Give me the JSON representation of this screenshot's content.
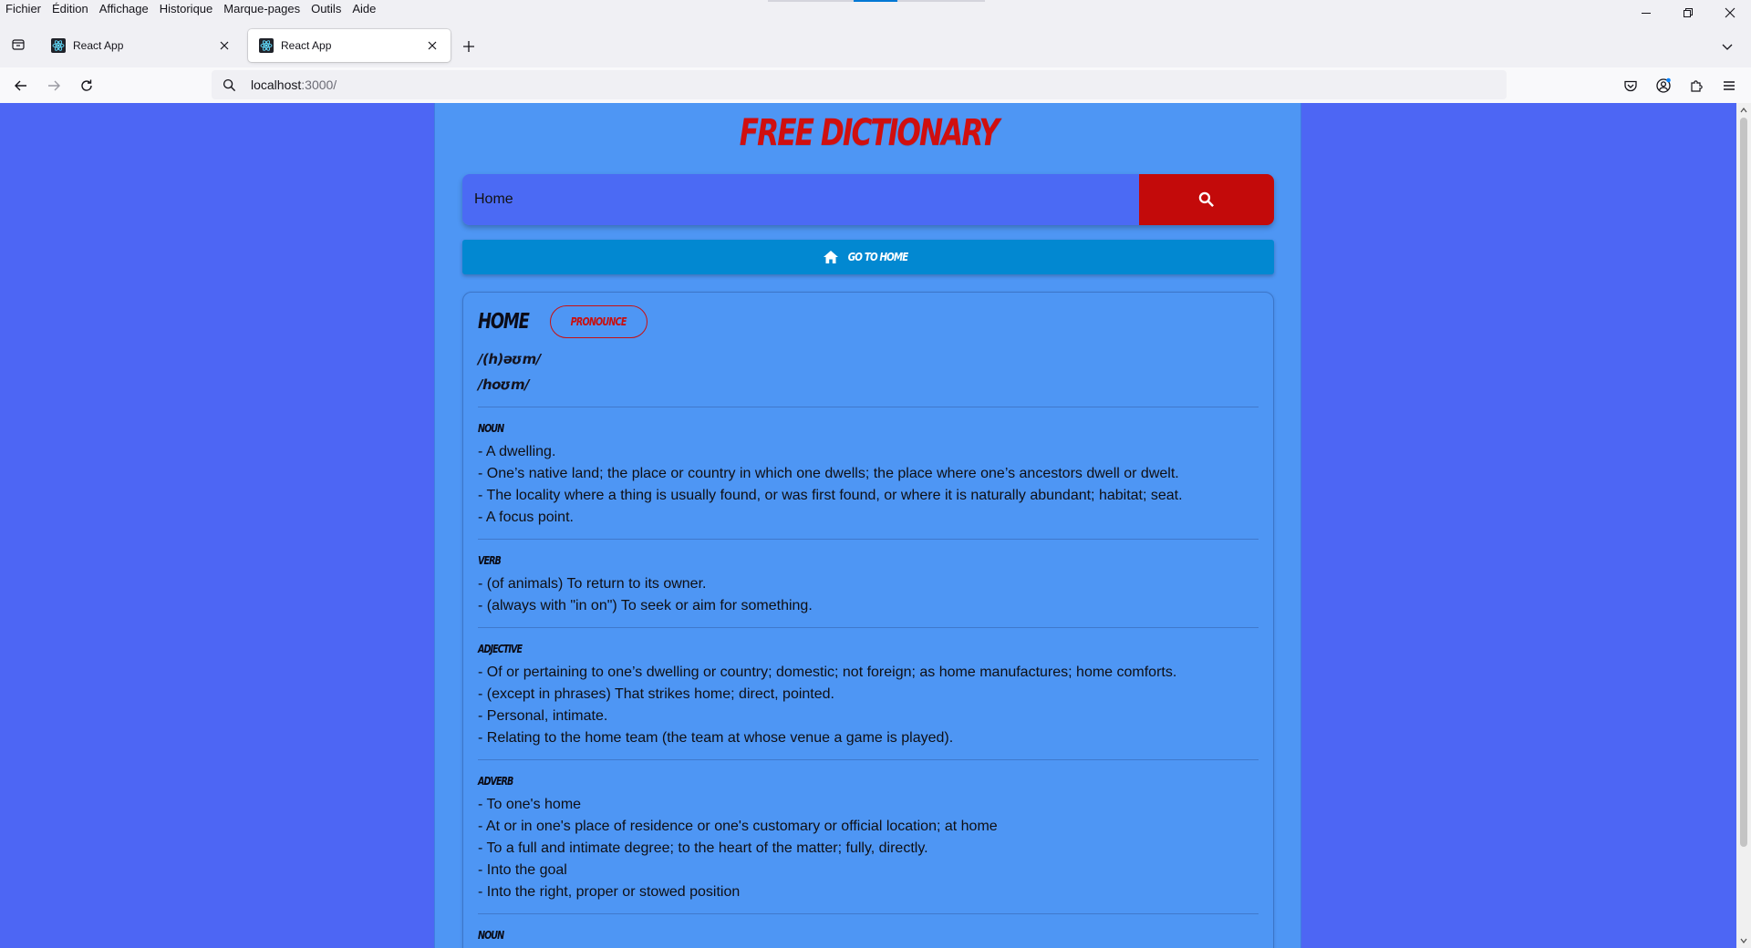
{
  "menubar": {
    "items": [
      "Fichier",
      "Édition",
      "Affichage",
      "Historique",
      "Marque-pages",
      "Outils",
      "Aide"
    ]
  },
  "tabs": [
    {
      "title": "React App",
      "active": false
    },
    {
      "title": "React App",
      "active": true
    }
  ],
  "navbar": {
    "url_host": "localhost",
    "url_port": ":3000/"
  },
  "app": {
    "brand": "FREE DICTIONARY",
    "search": {
      "value": "Home"
    },
    "home_button_label": "GO TO HOME",
    "entry": {
      "word": "HOME",
      "pronounce_label": "PRONOUNCE",
      "phonetics": [
        "/(h)əʊm/",
        "/hoʊm/"
      ],
      "meanings": [
        {
          "part_of_speech": "NOUN",
          "definitions": [
            "- A dwelling.",
            "- One’s native land; the place or country in which one dwells; the place where one’s ancestors dwell or dwelt.",
            "- The locality where a thing is usually found, or was first found, or where it is naturally abundant; habitat; seat.",
            "- A focus point."
          ]
        },
        {
          "part_of_speech": "VERB",
          "definitions": [
            "- (of animals) To return to its owner.",
            "- (always with \"in on\") To seek or aim for something."
          ]
        },
        {
          "part_of_speech": "ADJECTIVE",
          "definitions": [
            "- Of or pertaining to one’s dwelling or country; domestic; not foreign; as home manufactures; home comforts.",
            "- (except in phrases) That strikes home; direct, pointed.",
            "- Personal, intimate.",
            "- Relating to the home team (the team at whose venue a game is played)."
          ]
        },
        {
          "part_of_speech": "ADVERB",
          "definitions": [
            "- To one's home",
            "- At or in one's place of residence or one's customary or official location; at home",
            "- To a full and intimate degree; to the heart of the matter; fully, directly.",
            "- Into the goal",
            "- Into the right, proper or stowed position"
          ]
        },
        {
          "part_of_speech": "NOUN",
          "definitions": []
        }
      ]
    }
  },
  "colors": {
    "page_bg": "#4d66f4",
    "app_bg": "#4e96f4",
    "brand_red": "#d00f0f",
    "search_btn": "#c30a0a",
    "home_btn": "#0288d1"
  }
}
